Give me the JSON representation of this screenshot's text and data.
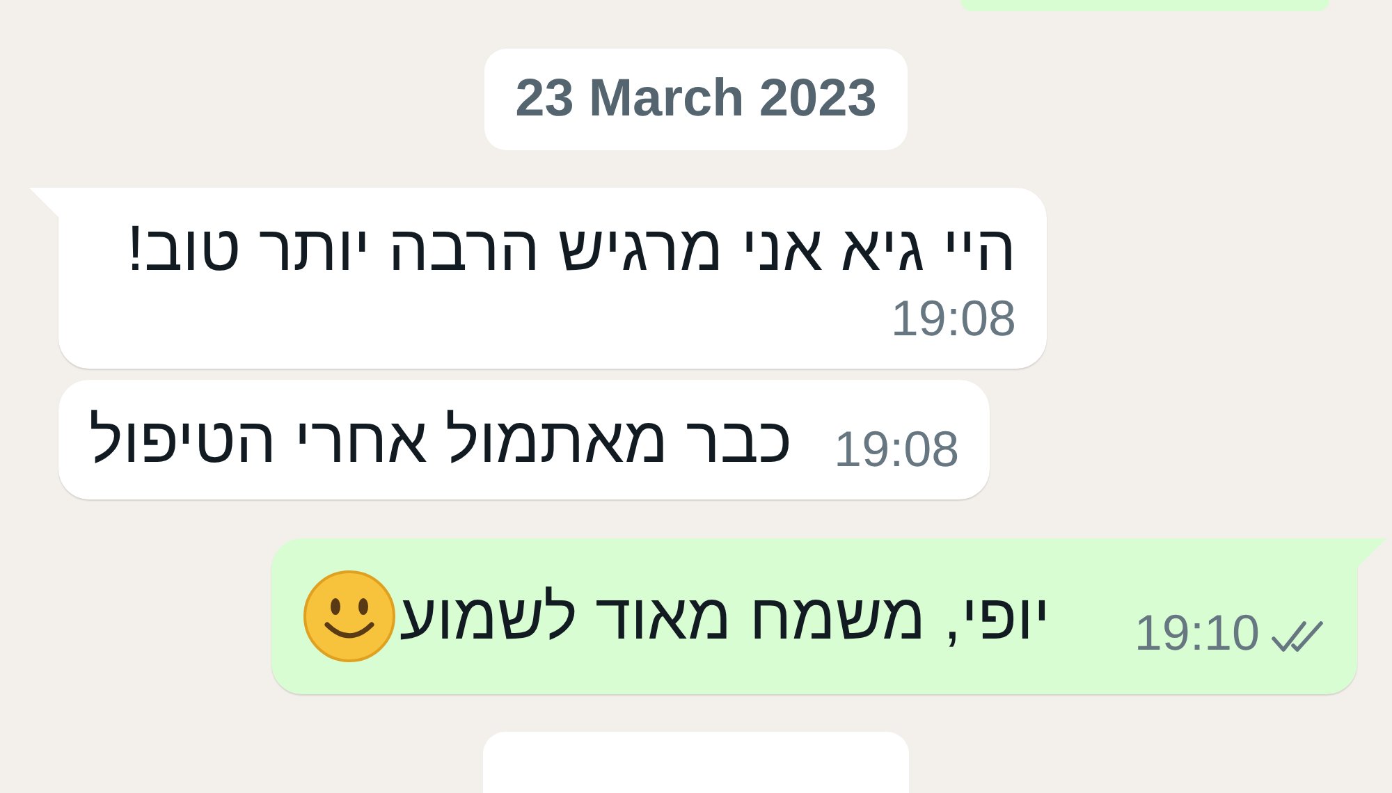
{
  "items": [
    {
      "kind": "date",
      "text": "23 March 2023"
    },
    {
      "kind": "incoming",
      "tail": true,
      "text": "היי גיא אני מרגיש הרבה יותר טוב!",
      "time": "19:08"
    },
    {
      "kind": "incoming",
      "tail": false,
      "text": "כבר מאתמול אחרי הטיפול",
      "time": "19:08"
    },
    {
      "kind": "outgoing",
      "tail": true,
      "text": "יופי, משמח מאוד לשמוע",
      "emoji": true,
      "time": "19:10",
      "read": false
    }
  ]
}
